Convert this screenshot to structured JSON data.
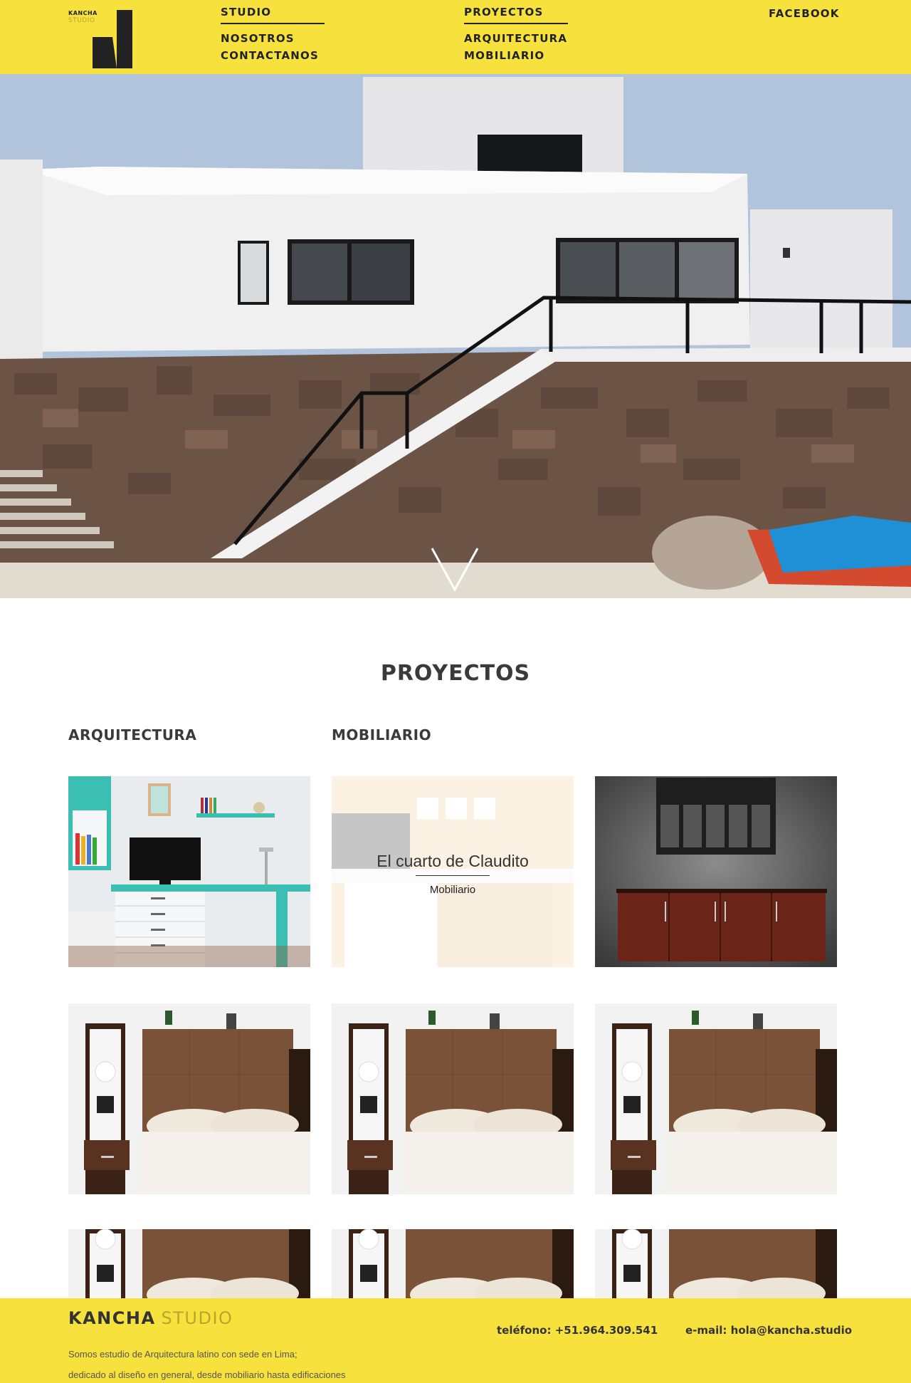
{
  "header": {
    "logo_top": "KANCHA",
    "logo_bottom": "STUDIO",
    "studio": {
      "label": "STUDIO",
      "items": [
        "NOSOTROS",
        "CONTACTANOS"
      ]
    },
    "proyectos": {
      "label": "PROYECTOS",
      "items": [
        "ARQUITECTURA",
        "MOBILIARIO"
      ]
    },
    "facebook": "FACEBOOK"
  },
  "hero": {
    "scroll_icon": "chevron-down-icon"
  },
  "main": {
    "title": "PROYECTOS",
    "categories": [
      "ARQUITECTURA",
      "MOBILIARIO"
    ],
    "projects": [
      {
        "image": "kids-room-desk",
        "title": "",
        "category": ""
      },
      {
        "image": "kids-room-desk",
        "title": "El cuarto de Claudito",
        "category": "Mobiliario"
      },
      {
        "image": "wood-sideboard",
        "title": "",
        "category": ""
      },
      {
        "image": "bedroom-headboard",
        "title": "",
        "category": ""
      },
      {
        "image": "bedroom-headboard",
        "title": "",
        "category": ""
      },
      {
        "image": "bedroom-headboard",
        "title": "",
        "category": ""
      },
      {
        "image": "bedroom-headboard",
        "title": "",
        "category": ""
      },
      {
        "image": "bedroom-headboard",
        "title": "",
        "category": ""
      },
      {
        "image": "bedroom-headboard",
        "title": "",
        "category": ""
      }
    ]
  },
  "footer": {
    "brand_bold": "KANCHA",
    "brand_light": "STUDIO",
    "desc_line1": "Somos estudio de Arquitectura latino con sede en Lima;",
    "desc_line2": "dedicado al diseño en general, desde mobiliario hasta edificaciones",
    "phone": "teléfono: +51.964.309.541",
    "email": "e-mail: hola@kancha.studio"
  },
  "colors": {
    "brand_yellow": "#f6e13d",
    "text_dark": "#333333",
    "accent_teal": "#3bbfb3"
  }
}
